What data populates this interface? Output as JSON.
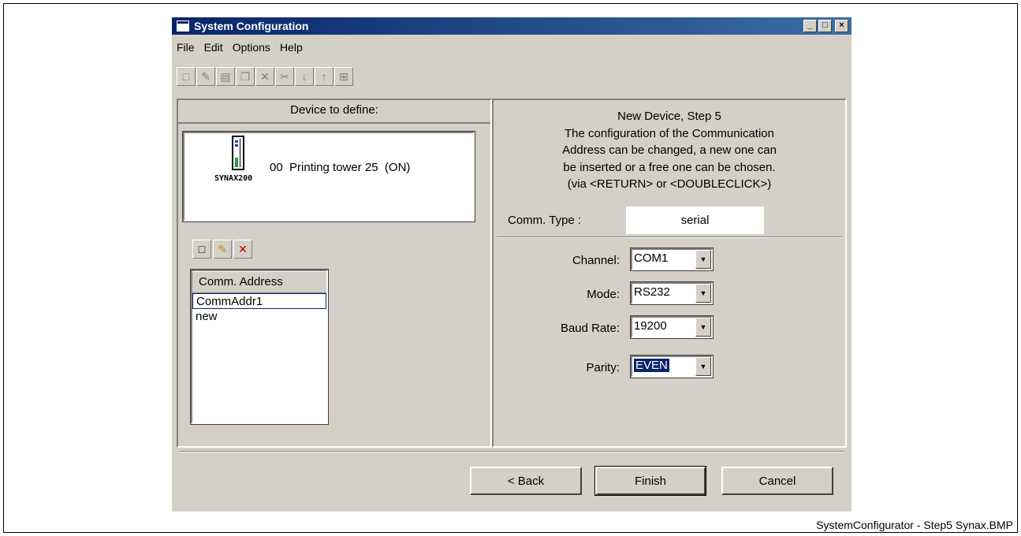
{
  "window": {
    "title": "System Configuration"
  },
  "menu": [
    "File",
    "Edit",
    "Options",
    "Help"
  ],
  "toolbar_icons": [
    "new-icon",
    "edit-icon",
    "paste-icon",
    "copy-icon",
    "delete-icon",
    "cut-icon",
    "move-down-icon",
    "move-up-icon",
    "tree-icon"
  ],
  "left": {
    "header": "Device to define:",
    "device_label": "SYNAX200",
    "device_text": "00  Printing tower 25  (ON)",
    "list_header": "Comm. Address",
    "items": [
      "CommAddr1",
      "new"
    ]
  },
  "right": {
    "title_lines": [
      "New Device, Step 5",
      "The configuration of the Communication",
      "Address can be changed, a new one can",
      "be inserted or a free one can be chosen.",
      "(via <RETURN> or <DOUBLECLICK>)"
    ],
    "comm_type_label": "Comm. Type :",
    "comm_type_value": "serial",
    "fields": [
      {
        "label": "Channel:",
        "value": "COM1"
      },
      {
        "label": "Mode:",
        "value": "RS232"
      },
      {
        "label": "Baud Rate:",
        "value": "19200"
      },
      {
        "label": "Parity:",
        "value": "EVEN"
      }
    ]
  },
  "buttons": {
    "back": "< Back",
    "finish": "Finish",
    "cancel": "Cancel"
  },
  "caption": "SystemConfigurator - Step5 Synax.BMP"
}
